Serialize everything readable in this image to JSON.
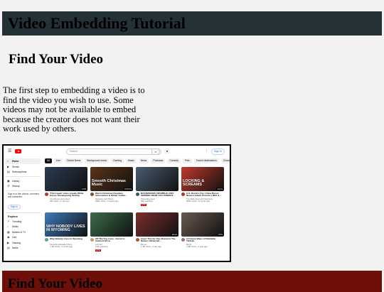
{
  "page": {
    "title": "Video Embedding Tutorial",
    "section_title": "Find Your Video",
    "paragraph": "The first step to embedding a video is to find the video you wish to use. Some videos may not be available to embed because the creator does not want their work used by others.",
    "next_section_title": "Find Your Video"
  },
  "screenshot": {
    "search_placeholder": "Search",
    "sign_in": "Sign in",
    "chips": [
      "All",
      "Live",
      "Global News",
      "Background music",
      "Gaming",
      "Music",
      "News",
      "Podcasts",
      "Comedy",
      "Pets",
      "Tourist destinations",
      "Characters"
    ],
    "sidebar": {
      "items_top": [
        {
          "icon": "⌂",
          "label": "Home",
          "active": true
        },
        {
          "icon": "▶",
          "label": "Shorts",
          "active": false
        },
        {
          "icon": "▤",
          "label": "Subscriptions",
          "active": false
        }
      ],
      "items_mid": [
        {
          "icon": "▣",
          "label": "Library",
          "active": false
        },
        {
          "icon": "↺",
          "label": "History",
          "active": false
        }
      ],
      "note": "Sign in to like videos, comment and subscribe.",
      "sign_in": "Sign in",
      "explore_header": "Explore",
      "explore": [
        {
          "icon": "↗",
          "label": "Trending"
        },
        {
          "icon": "♪",
          "label": "Music"
        },
        {
          "icon": "▦",
          "label": "Movies & TV"
        },
        {
          "icon": "◉",
          "label": "Live"
        },
        {
          "icon": "▶",
          "label": "Gaming"
        },
        {
          "icon": "▤",
          "label": "News"
        }
      ]
    },
    "videos": [
      {
        "title": "'Third week' video reveals White House Thanksgiving Setting",
        "channel": "Amy Brown and others",
        "meta": "842 views • 1 day ago",
        "duration": "0:58",
        "thumb_text": "",
        "bg": "#2a3b52",
        "avatar": "#b33",
        "live": false
      },
      {
        "title": "Warm Christmas Fireplace Atmosphere & Winter Coffee...",
        "channel": "Relaxing Jazz Piano",
        "meta": "295K views • 3 weeks ago",
        "duration": "3:05:01",
        "thumb_text": "Smooth Christmas Music",
        "bg": "#5a3418",
        "avatar": "#7a5230",
        "live": false
      },
      {
        "title": "BACKWOODS CRUMBLE! 2023 ORDERS FROM YOU TONIGHT...",
        "channel": "Tahoe Exposed",
        "meta": "49K watching",
        "duration": "",
        "thumb_text": "",
        "bg": "#4a5d70",
        "avatar": "#355",
        "live": true
      },
      {
        "title": "U.S. Bomb's Fire: China Bursts Newest Attack Protests | REX &...",
        "channel": "The Daily Roar with Stephens",
        "meta": "856K views • 12 hours ago",
        "duration": "14:01",
        "thumb_text": "LOCKING & SCREAMS",
        "bg": "#c0392b",
        "avatar": "#a33",
        "live": false
      },
      {
        "title": "Why Nobody Lives In Wyoming",
        "channel": "Something Related Films",
        "meta": "1.4M views • 1 month ago",
        "duration": "",
        "thumb_text": "WHY NOBODY LIVES IN WYOMING",
        "bg": "#3e7bbd",
        "avatar": "#5a8",
        "live": false
      },
      {
        "title": "Off The Top Lives - Insisit to Inskrivit-IVo-te",
        "channel": "Lofi Girl",
        "meta": "2.6K watching",
        "duration": "",
        "thumb_text": "",
        "bg": "#3b6e4a",
        "avatar": "#c96",
        "live": true
      },
      {
        "title": "Insert This for Dice Drama In The Nether | Minecraft...",
        "channel": "Boxun",
        "meta": "1.4M views • 1 day ago",
        "duration": "18:42",
        "thumb_text": "",
        "bg": "#7a2e2e",
        "avatar": "#a52",
        "live": false
      },
      {
        "title": "12 Cutest Ways of Relatable TikToks",
        "channel": "Boxer",
        "meta": "4.6M views • 1 year ago",
        "duration": "8:55",
        "thumb_text": "",
        "bg": "#6b5a4f",
        "avatar": "#976",
        "live": false
      }
    ]
  }
}
